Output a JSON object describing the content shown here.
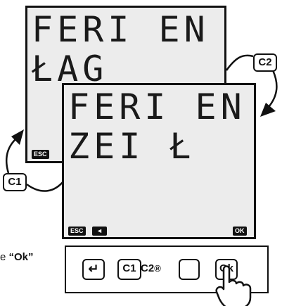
{
  "back_screen": {
    "line1": "FERI EN",
    "line2": "ŁAG",
    "softkey_esc": "ESC"
  },
  "front_screen": {
    "line1": "FERI EN",
    "line2": "ZEI Ł",
    "softkey_esc": "ESC",
    "softkey_left": "◄",
    "softkey_ok": "OK"
  },
  "callouts": {
    "c1": "C1",
    "c2": "C2"
  },
  "instruction": {
    "prefix": "e ",
    "bold": "“Ok”"
  },
  "keypad": {
    "enter_symbol": "↵",
    "c1_label": "C1",
    "c2_label": "C2",
    "reg_symbol": "®",
    "ok_label": "Ok"
  }
}
